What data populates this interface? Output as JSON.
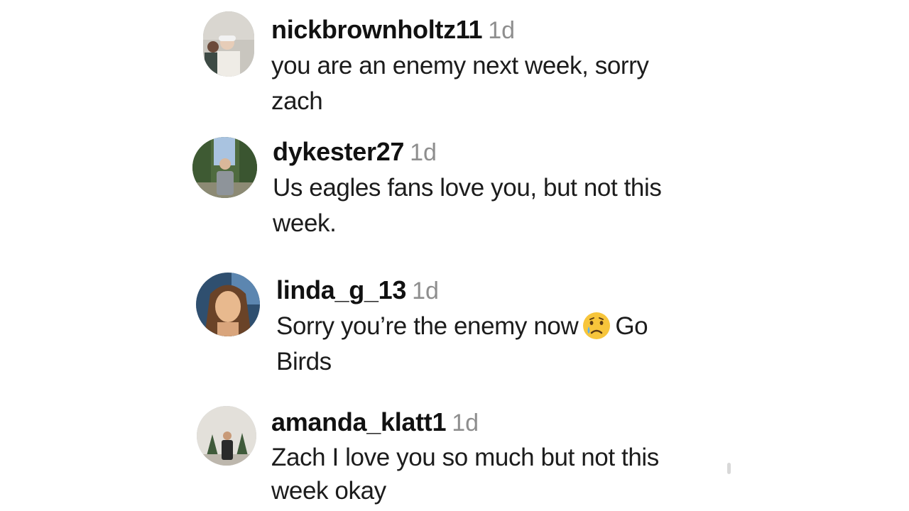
{
  "comments": [
    {
      "username": "nickbrownholtz11",
      "time": "1d",
      "lines": [
        "you are an enemy next week, sorry",
        "zach"
      ],
      "avatar_icon": "avatar-photo-two-people"
    },
    {
      "username": "dykester27",
      "time": "1d",
      "lines": [
        "Us eagles fans love you, but not this",
        "week."
      ],
      "avatar_icon": "avatar-photo-person-outdoors"
    },
    {
      "username": "linda_g_13",
      "time": "1d",
      "lines": [
        "Sorry you’re the enemy now",
        "Go",
        "Birds"
      ],
      "emoji": "crying-face-emoji",
      "avatar_icon": "avatar-photo-selfie"
    },
    {
      "username": "amanda_klatt1",
      "time": "1d",
      "lines": [
        "Zach I love you so much but not this",
        "week okay"
      ],
      "avatar_icon": "avatar-photo-person-with-trees"
    }
  ]
}
